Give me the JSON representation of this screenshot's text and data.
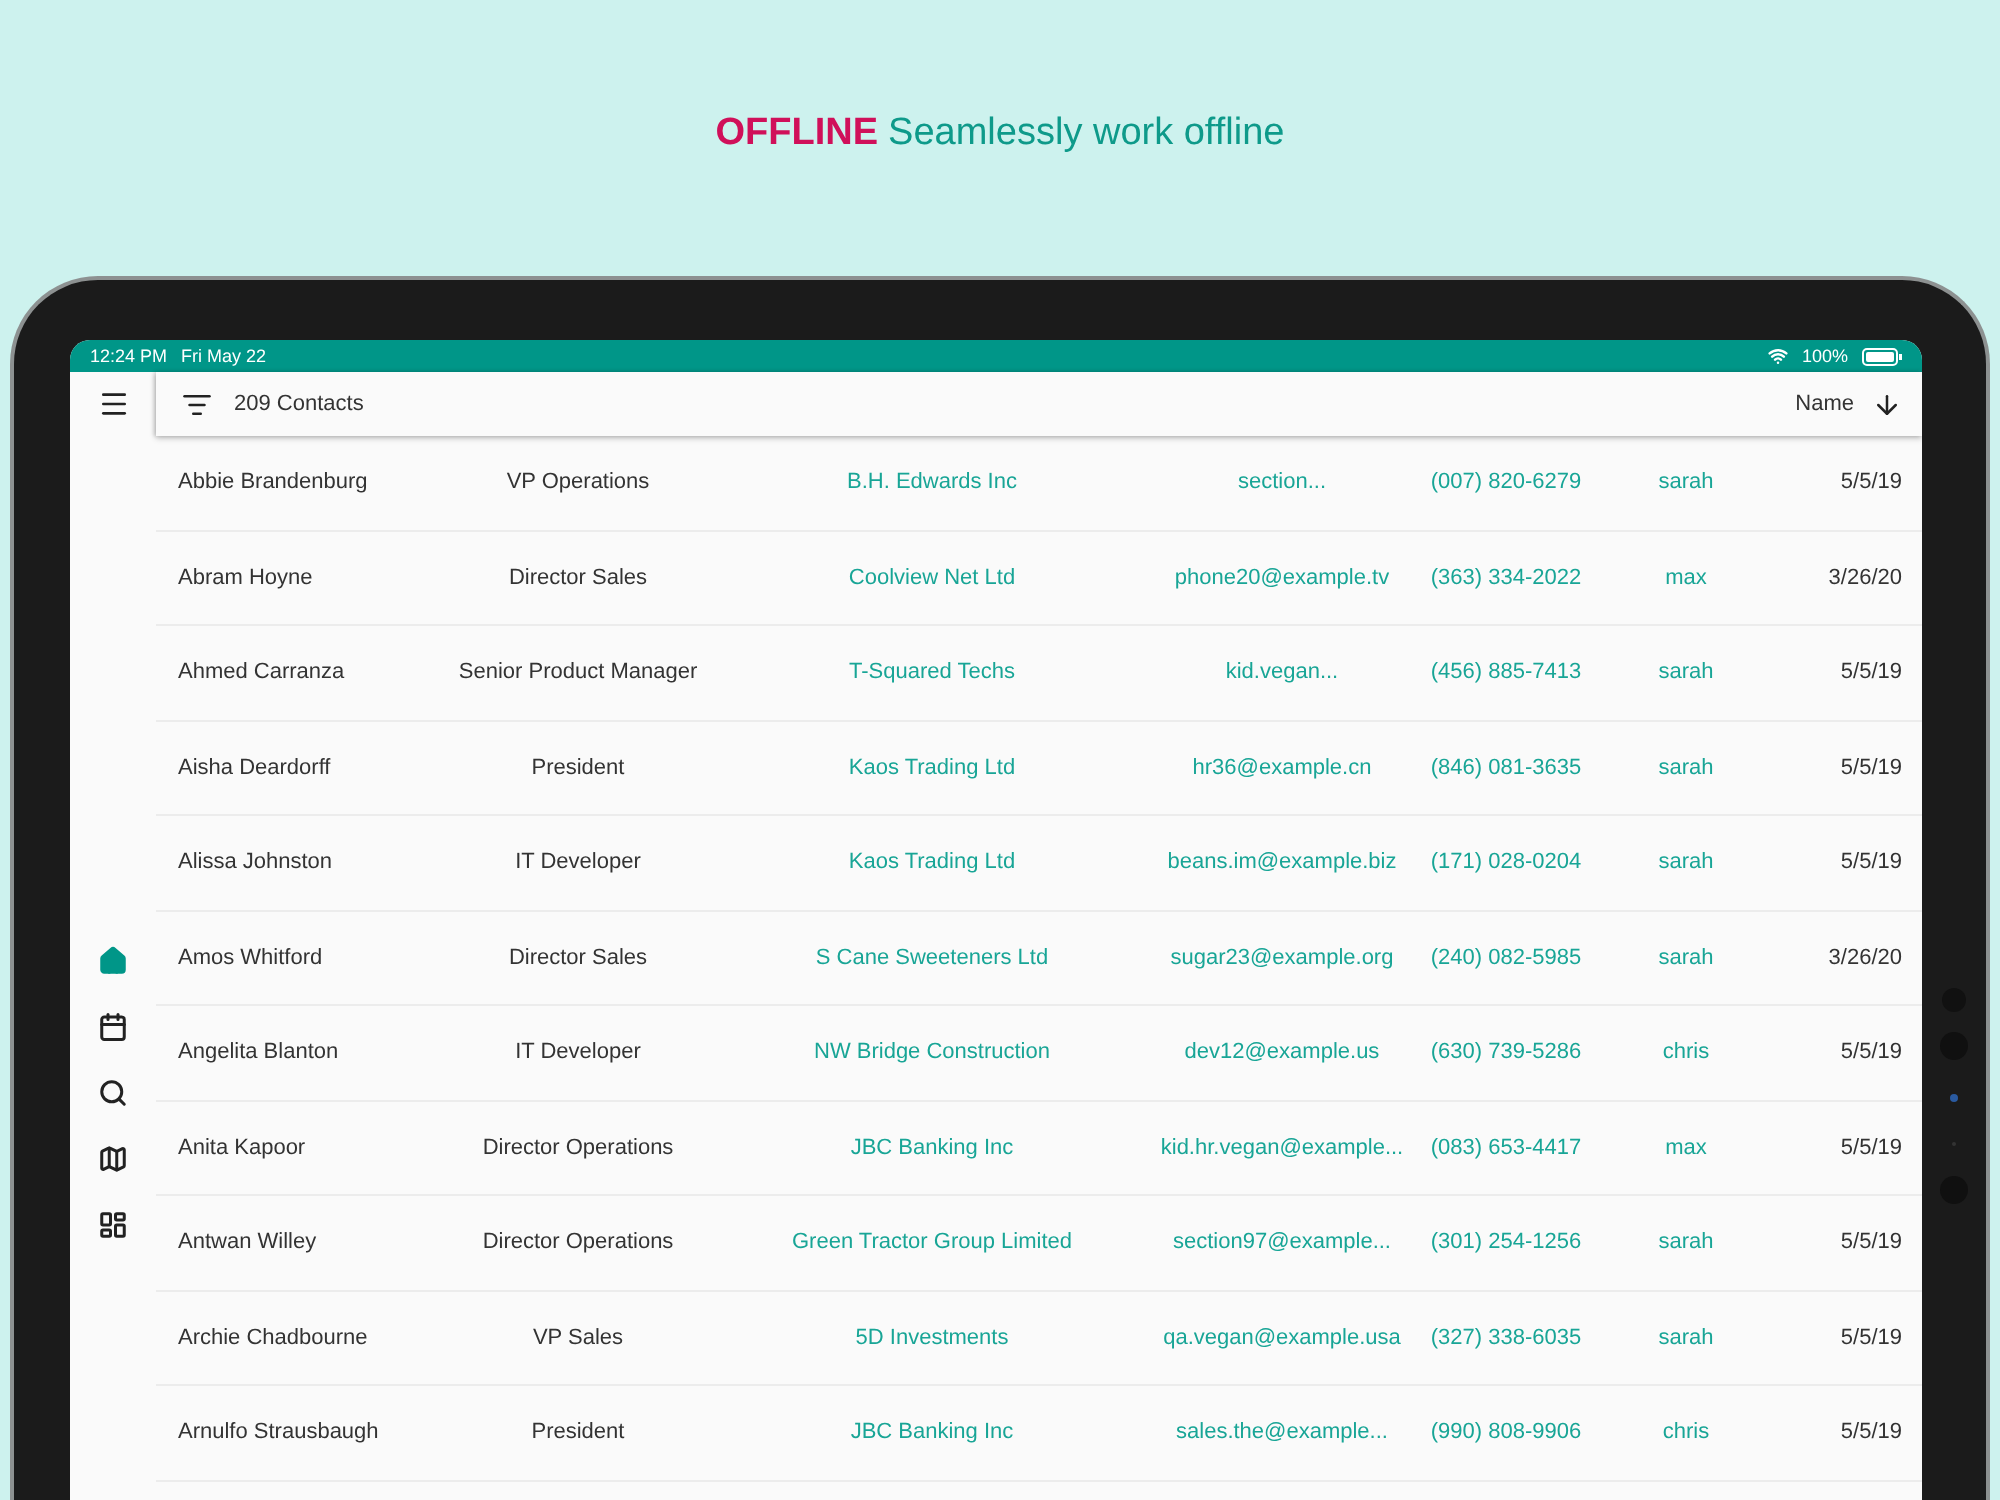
{
  "headline": {
    "emphasis": "OFFLINE",
    "text": "Seamlessly work offline"
  },
  "status_bar": {
    "time": "12:24 PM",
    "date": "Fri May 22",
    "battery": "100%"
  },
  "toolbar": {
    "count": "209 Contacts",
    "sort_label": "Name"
  },
  "nav": [
    {
      "kind": "home",
      "selected": true
    },
    {
      "kind": "calendar",
      "selected": false
    },
    {
      "kind": "search",
      "selected": false
    },
    {
      "kind": "map",
      "selected": false
    },
    {
      "kind": "dashboard",
      "selected": false
    }
  ],
  "contacts": [
    {
      "name": "Abbie Brandenburg",
      "title": "VP Operations",
      "company": "B.H. Edwards Inc",
      "email": "section...",
      "phone": "(007) 820-6279",
      "owner": "sarah",
      "date": "5/5/19"
    },
    {
      "name": "Abram Hoyne",
      "title": "Director Sales",
      "company": "Coolview Net Ltd",
      "email": "phone20@example.tv",
      "phone": "(363) 334-2022",
      "owner": "max",
      "date": "3/26/20"
    },
    {
      "name": "Ahmed Carranza",
      "title": "Senior Product Manager",
      "company": "T-Squared Techs",
      "email": "kid.vegan...",
      "phone": "(456) 885-7413",
      "owner": "sarah",
      "date": "5/5/19"
    },
    {
      "name": "Aisha Deardorff",
      "title": "President",
      "company": "Kaos Trading Ltd",
      "email": "hr36@example.cn",
      "phone": "(846) 081-3635",
      "owner": "sarah",
      "date": "5/5/19"
    },
    {
      "name": "Alissa Johnston",
      "title": "IT Developer",
      "company": "Kaos Trading Ltd",
      "email": "beans.im@example.biz",
      "phone": "(171) 028-0204",
      "owner": "sarah",
      "date": "5/5/19"
    },
    {
      "name": "Amos Whitford",
      "title": "Director Sales",
      "company": "S Cane Sweeteners Ltd",
      "email": "sugar23@example.org",
      "phone": "(240) 082-5985",
      "owner": "sarah",
      "date": "3/26/20"
    },
    {
      "name": "Angelita Blanton",
      "title": "IT Developer",
      "company": "NW Bridge Construction",
      "email": "dev12@example.us",
      "phone": "(630) 739-5286",
      "owner": "chris",
      "date": "5/5/19"
    },
    {
      "name": "Anita Kapoor",
      "title": "Director Operations",
      "company": "JBC Banking Inc",
      "email": "kid.hr.vegan@example...",
      "phone": "(083) 653-4417",
      "owner": "max",
      "date": "5/5/19"
    },
    {
      "name": "Antwan Willey",
      "title": "Director Operations",
      "company": "Green Tractor Group Limited",
      "email": "section97@example...",
      "phone": "(301) 254-1256",
      "owner": "sarah",
      "date": "5/5/19"
    },
    {
      "name": "Archie Chadbourne",
      "title": "VP Sales",
      "company": "5D Investments",
      "email": "qa.vegan@example.usa",
      "phone": "(327) 338-6035",
      "owner": "sarah",
      "date": "5/5/19"
    },
    {
      "name": "Arnulfo Strausbaugh",
      "title": "President",
      "company": "JBC Banking Inc",
      "email": "sales.the@example...",
      "phone": "(990) 808-9906",
      "owner": "chris",
      "date": "5/5/19"
    }
  ]
}
